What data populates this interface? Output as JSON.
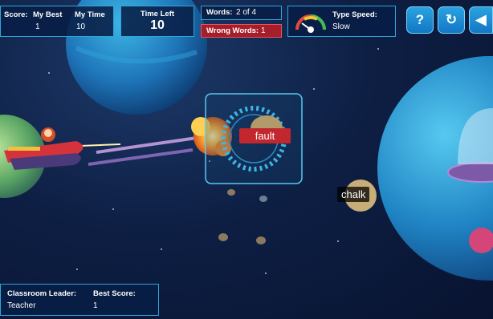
{
  "hud": {
    "score_label": "Score:",
    "score_value": "",
    "best_label": "My Best",
    "best_value": "1",
    "time_label": "My Time",
    "time_value": "10",
    "time_left_label": "Time Left",
    "time_left_value": "10",
    "words_label": "Words:",
    "words_value": "2 of 4",
    "wrong_label": "Wrong Words:",
    "wrong_value": "1",
    "type_speed_label": "Type Speed:",
    "type_speed_value": "Slow"
  },
  "buttons": {
    "help_label": "?",
    "restart_label": "↻",
    "sound_label": "◀"
  },
  "targets": {
    "active_word": "fault",
    "next_word": "chalk"
  },
  "leader": {
    "leader_label": "Classroom Leader:",
    "leader_value": "Teacher",
    "best_label": "Best Score:",
    "best_value": "1"
  },
  "colors": {
    "accent": "#2fa6d6",
    "wrong": "#c1272d",
    "button": "#1c8fd6"
  }
}
